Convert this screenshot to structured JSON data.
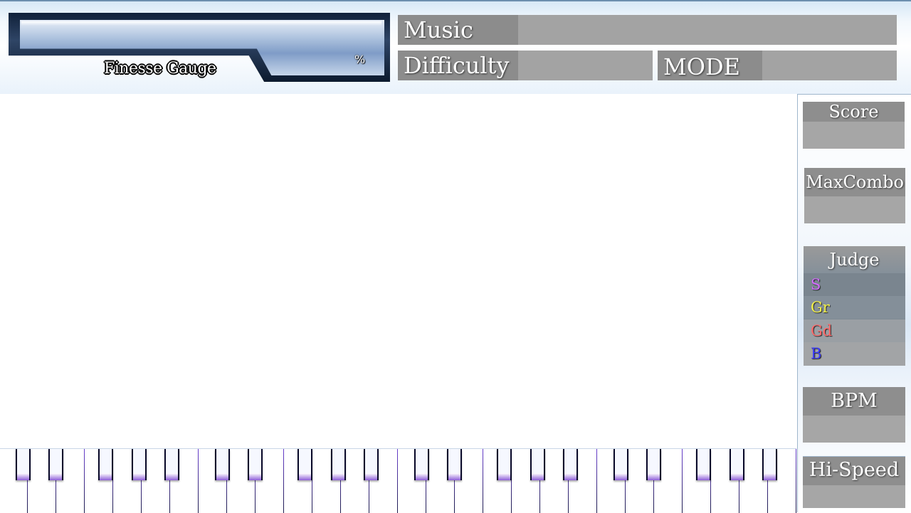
{
  "gauge": {
    "label": "Finesse Gauge",
    "percent_symbol": "%"
  },
  "info": {
    "music_label": "Music",
    "difficulty_label": "Difficulty",
    "mode_label": "MODE"
  },
  "side": {
    "score_label": "Score",
    "maxcombo_label": "MaxCombo",
    "judge_label": "Judge",
    "judges": [
      {
        "label": "S",
        "color": "#d36bff"
      },
      {
        "label": "Gr",
        "color": "#f4f24a"
      },
      {
        "label": "Gd",
        "color": "#ff6b6b"
      },
      {
        "label": "B",
        "color": "#3b3bff"
      }
    ],
    "bpm_label": "BPM",
    "hispeed_label": "Hi-Speed"
  },
  "colors": {
    "panel": "#a3a3a3",
    "panel_label": "#8c8c8c",
    "key_accent": "#8e5fd8"
  }
}
